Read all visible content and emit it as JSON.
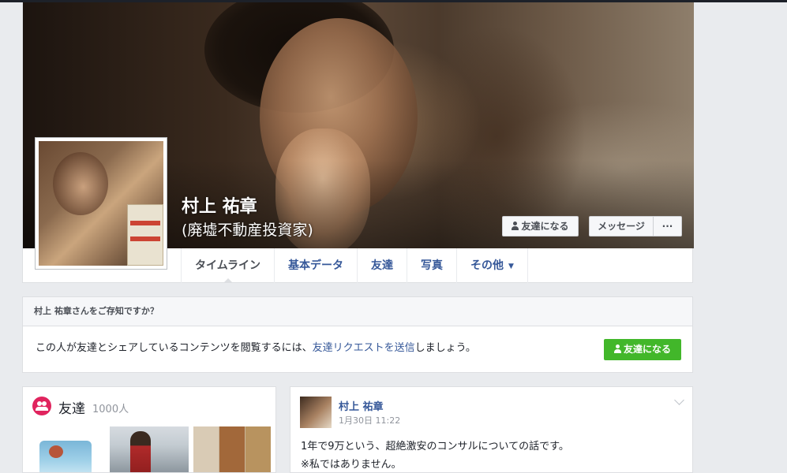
{
  "profile": {
    "name": "村上 祐章",
    "subtitle": "(廃墟不動産投資家)",
    "add_friend_label": "友達になる",
    "message_label": "メッセージ",
    "more_label": "···"
  },
  "tabs": [
    {
      "label": "タイムライン"
    },
    {
      "label": "基本データ"
    },
    {
      "label": "友達"
    },
    {
      "label": "写真"
    },
    {
      "label": "その他"
    }
  ],
  "know_box": {
    "heading": "村上 祐章さんをご存知ですか？",
    "text_before": "この人が友達とシェアしているコンテンツを閲覧するには、",
    "link_text": "友達リクエストを送信",
    "text_after": "しましょう。",
    "button_label": "友達になる"
  },
  "friends_box": {
    "title": "友達",
    "count": "1000人"
  },
  "post": {
    "author": "村上 祐章",
    "time": "1月30日 11:22",
    "line1": "1年で9万という、超絶激安のコンサルについての話です。",
    "line2": "※私ではありません。"
  },
  "colors": {
    "link": "#365899",
    "green_button": "#42b72a",
    "friends_icon": "#e0245e",
    "page_bg": "#e9ebee"
  }
}
